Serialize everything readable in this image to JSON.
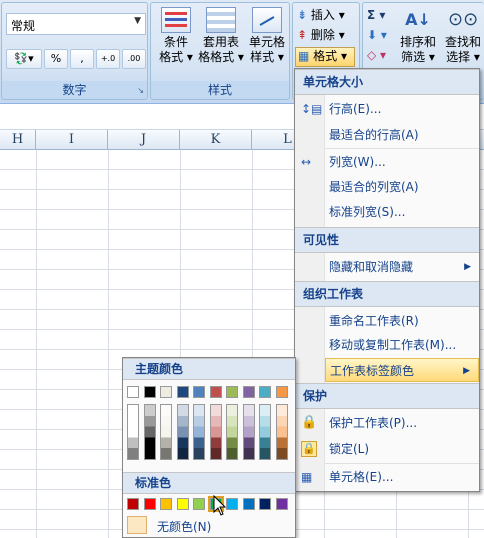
{
  "ribbon": {
    "number_group": {
      "format_value": "常规",
      "group_label": "数字",
      "buttons": [
        "%",
        ",",
        "+.0 .00",
        ".00 →.0"
      ]
    },
    "styles_group": {
      "group_label": "样式",
      "conditional_label": "条件\n格式",
      "conditional_line1": "条件",
      "conditional_line2": "格式",
      "table_line1": "套用表",
      "table_line2": "格格式",
      "cell_line1": "单元格",
      "cell_line2": "样式"
    },
    "cells_group": {
      "insert_label": "插入",
      "delete_label": "删除",
      "format_label": "格式"
    },
    "editing_group": {
      "sigma": "Σ",
      "sort_line1": "排序和",
      "sort_line2": "筛选",
      "find_line1": "查找和",
      "find_line2": "选择"
    }
  },
  "columns": [
    "H",
    "I",
    "J",
    "K",
    "L"
  ],
  "format_menu": {
    "cell_size_header": "单元格大小",
    "row_height": "行高(E)...",
    "autofit_row": "最适合的行高(A)",
    "col_width": "列宽(W)...",
    "autofit_col": "最适合的列宽(A)",
    "default_width": "标准列宽(S)...",
    "visibility_header": "可见性",
    "hide_unhide": "隐藏和取消隐藏",
    "organize_header": "组织工作表",
    "rename": "重命名工作表(R)",
    "move_copy": "移动或复制工作表(M)...",
    "tab_color": "工作表标签颜色",
    "protection_header": "保护",
    "protect_sheet": "保护工作表(P)...",
    "lock": "锁定(L)",
    "format_cells": "单元格(E)..."
  },
  "color_palette": {
    "theme_header": "主题颜色",
    "standard_header": "标准色",
    "no_color": "无颜色(N)",
    "theme_colors": [
      "#ffffff",
      "#000000",
      "#eeece1",
      "#1f497d",
      "#4f81bd",
      "#c0504d",
      "#9bbb59",
      "#8064a2",
      "#4bacc6",
      "#f79646"
    ],
    "standard_colors": [
      "#c00000",
      "#ff0000",
      "#ffc000",
      "#ffff00",
      "#92d050",
      "#00b050",
      "#00b0f0",
      "#0070c0",
      "#002060",
      "#7030a0"
    ],
    "selected_standard": "#00b050"
  }
}
